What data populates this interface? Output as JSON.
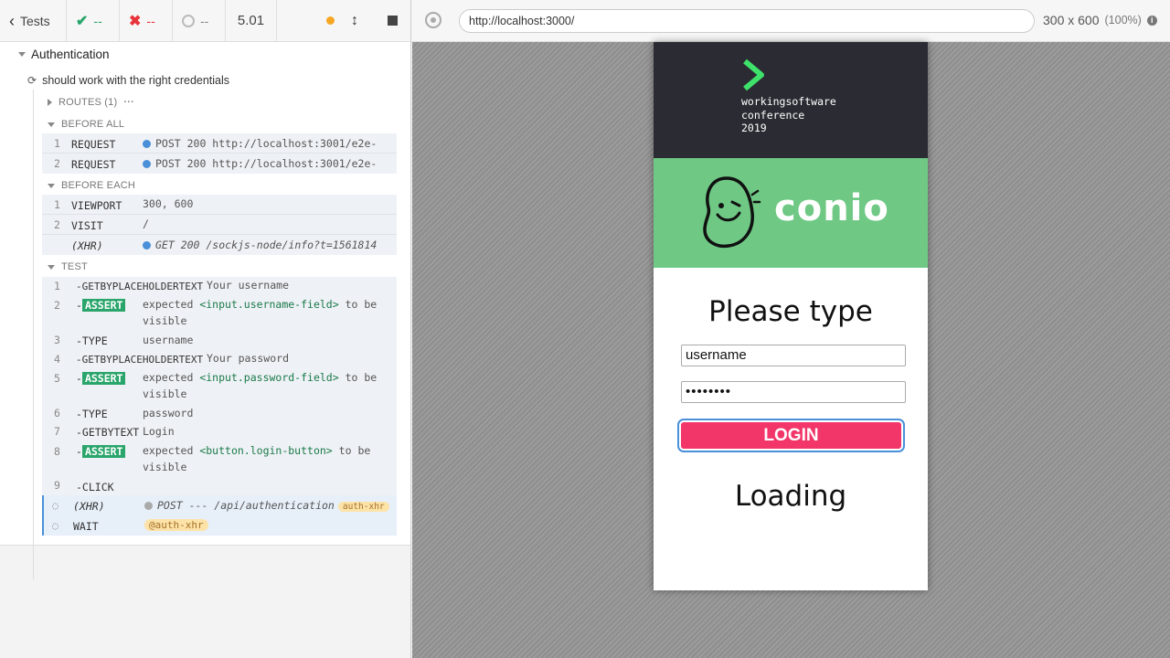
{
  "toolbar": {
    "tests_label": "Tests",
    "passed": "--",
    "failed": "--",
    "pending": "--",
    "duration": "5.01"
  },
  "reporter": {
    "suite": "Authentication",
    "test": "should work with the right credentials",
    "routes_label": "ROUTES (1)",
    "before_all_label": "BEFORE ALL",
    "before_all": [
      {
        "num": "1",
        "name": "REQUEST",
        "msg": "POST 200 http://localhost:3001/e2e-"
      },
      {
        "num": "2",
        "name": "REQUEST",
        "msg": "POST 200 http://localhost:3001/e2e-"
      }
    ],
    "before_each_label": "BEFORE EACH",
    "before_each": [
      {
        "num": "1",
        "name": "VIEWPORT",
        "msg": "300, 600"
      },
      {
        "num": "2",
        "name": "VISIT",
        "msg": "/"
      },
      {
        "num": "",
        "name": "(XHR)",
        "msg": "GET 200 /sockjs-node/info?t=1561814"
      }
    ],
    "test_label": "TEST",
    "commands": {
      "c1": {
        "num": "1",
        "name": "-GETBYPLACEHOLDERTEXT",
        "msg": "Your username"
      },
      "c2": {
        "num": "2",
        "name": "ASSERT",
        "msg_a": "expected",
        "msg_b": "<input.username-field>",
        "msg_c": "to be",
        "msg_d": "visible"
      },
      "c3": {
        "num": "3",
        "name": "-TYPE",
        "msg": "username"
      },
      "c4": {
        "num": "4",
        "name": "-GETBYPLACEHOLDERTEXT",
        "msg": "Your password"
      },
      "c5": {
        "num": "5",
        "name": "ASSERT",
        "msg_a": "expected",
        "msg_b": "<input.password-field>",
        "msg_c": "to be",
        "msg_d": "visible"
      },
      "c6": {
        "num": "6",
        "name": "-TYPE",
        "msg": "password"
      },
      "c7": {
        "num": "7",
        "name": "-GETBYTEXT",
        "msg": "Login"
      },
      "c8": {
        "num": "8",
        "name": "ASSERT",
        "msg_a": "expected",
        "msg_b": "<button.login-button>",
        "msg_c": "to be",
        "msg_d": "visible"
      },
      "c9": {
        "num": "9",
        "name": "-CLICK",
        "msg": ""
      },
      "xhr": {
        "name": "(XHR)",
        "msg": "POST --- /api/authentication",
        "tag": "auth-xhr"
      },
      "wait": {
        "name": "WAIT",
        "tag": "@auth-xhr"
      }
    }
  },
  "browser": {
    "url": "http://localhost:3000/",
    "viewport": "300 x 600",
    "scale": "(100%)"
  },
  "app": {
    "conference": [
      "workingsoftware",
      "conference",
      "2019"
    ],
    "brand": "conio",
    "heading": "Please type",
    "username_value": "username",
    "password_value": "••••••••",
    "login_label": "LOGIN",
    "loading": "Loading"
  },
  "colors": {
    "conference_bg": "#2b2c33",
    "brand_bg": "#6fc985",
    "login_bg": "#f2366a",
    "pass": "#2aa56b",
    "fail": "#e8333b"
  }
}
